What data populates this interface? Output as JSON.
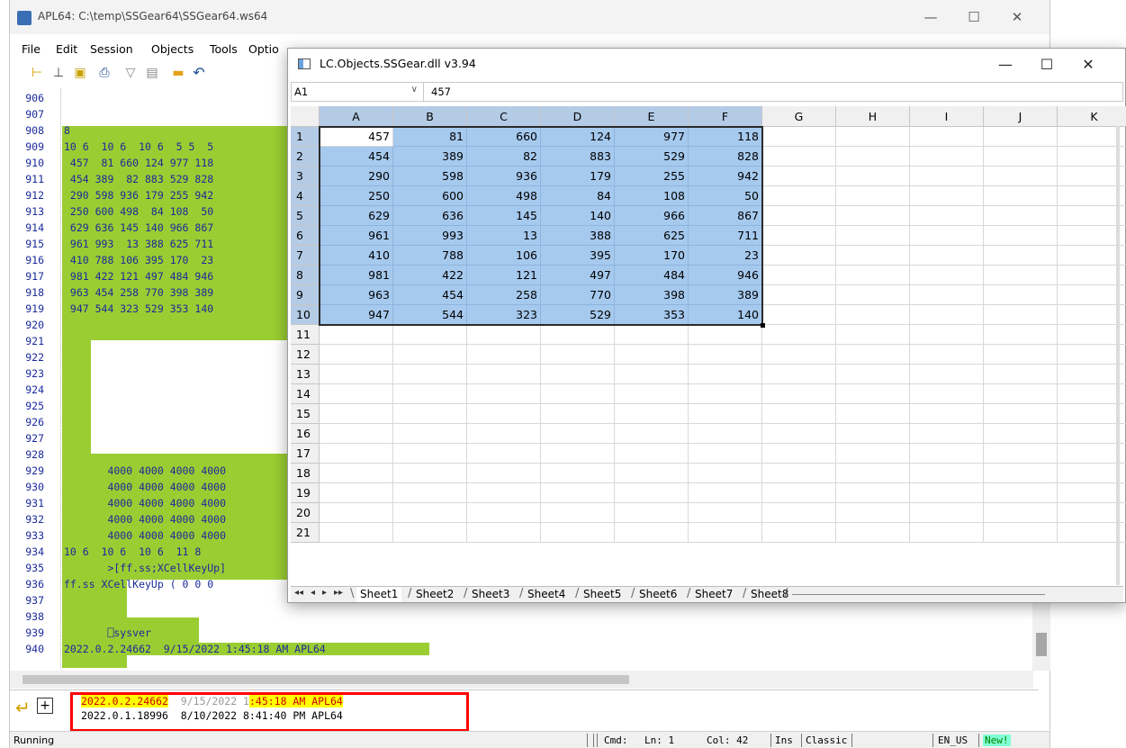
{
  "main_window": {
    "title": "APL64: C:\\temp\\SSGear64\\SSGear64.ws64",
    "controls": {
      "minimize": "—",
      "maximize": "☐",
      "close": "✕"
    }
  },
  "menu": [
    "File",
    "Edit",
    "Session",
    "Objects",
    "Tools",
    "Optio"
  ],
  "toolbar_icons": [
    "indent-icon",
    "step-icon",
    "save-icon",
    "print-icon",
    "shape-icon",
    "document-icon",
    "folder-icon",
    "undo-icon"
  ],
  "session": {
    "line_numbers": [
      "906",
      "907",
      "908",
      "909",
      "910",
      "911",
      "912",
      "913",
      "914",
      "915",
      "916",
      "917",
      "918",
      "919",
      "920",
      "921",
      "922",
      "923",
      "924",
      "925",
      "926",
      "927",
      "928",
      "929",
      "930",
      "931",
      "932",
      "933",
      "934",
      "935",
      "936",
      "937",
      "938",
      "939",
      "940"
    ],
    "lines": {
      "l908": "8",
      "l909": "10 6  10 6  10 6  5 5  5",
      "l910": " 457  81 660 124 977 118",
      "l911": " 454 389  82 883 529 828",
      "l912": " 290 598 936 179 255 942",
      "l913": " 250 600 498  84 108  50",
      "l914": " 629 636 145 140 966 867",
      "l915": " 961 993  13 388 625 711",
      "l916": " 410 788 106 395 170  23",
      "l917": " 981 422 121 497 484 946",
      "l918": " 963 454 258 770 398 389",
      "l919": " 947 544 323 529 353 140",
      "l928": "       4000 4000 4000 4000",
      "l929": "       4000 4000 4000 4000",
      "l930": "       4000 4000 4000 4000",
      "l931": "       4000 4000 4000 4000",
      "l932": "       4000 4000 4000 4000",
      "l933": "10 6  10 6  10 6  11 8",
      "l934": "       >[ff.ss;XCellKeyUp]",
      "l935": "ff.ss XCellKeyUp ( 0 0 0",
      "l938": "       ⎕sysver",
      "l939": "2022.0.2.24662  9/15/2022 1:45:18 AM APL64"
    }
  },
  "history": {
    "entry1": {
      "version": "2022.0.2.24662",
      "date_a": "9/15/",
      "date_b": "2022 1",
      "time": ":45:18 AM APL64"
    },
    "entry2": "2022.0.1.18996  8/10/2022 8:41:40 PM APL64"
  },
  "statusbar": {
    "state": "Running",
    "cmd": "Cmd:",
    "ln": "Ln: 1",
    "col": "Col: 42",
    "mode": "Ins",
    "style": "Classic",
    "locale": "EN_US",
    "new": "New!"
  },
  "spreadsheet": {
    "title": "LC.Objects.SSGear.dll v3.94",
    "controls": {
      "minimize": "—",
      "maximize": "☐",
      "close": "✕"
    },
    "name_box": "A1",
    "dropdown": "∨",
    "formula": "457",
    "columns": [
      "A",
      "B",
      "C",
      "D",
      "E",
      "F",
      "G",
      "H",
      "I",
      "J",
      "K"
    ],
    "rows": [
      "1",
      "2",
      "3",
      "4",
      "5",
      "6",
      "7",
      "8",
      "9",
      "10",
      "11",
      "12",
      "13",
      "14",
      "15",
      "16",
      "17",
      "18",
      "19",
      "20",
      "21"
    ],
    "values": [
      [
        "457",
        "81",
        "660",
        "124",
        "977",
        "118"
      ],
      [
        "454",
        "389",
        "82",
        "883",
        "529",
        "828"
      ],
      [
        "290",
        "598",
        "936",
        "179",
        "255",
        "942"
      ],
      [
        "250",
        "600",
        "498",
        "84",
        "108",
        "50"
      ],
      [
        "629",
        "636",
        "145",
        "140",
        "966",
        "867"
      ],
      [
        "961",
        "993",
        "13",
        "388",
        "625",
        "711"
      ],
      [
        "410",
        "788",
        "106",
        "395",
        "170",
        "23"
      ],
      [
        "981",
        "422",
        "121",
        "497",
        "484",
        "946"
      ],
      [
        "963",
        "454",
        "258",
        "770",
        "398",
        "389"
      ],
      [
        "947",
        "544",
        "323",
        "529",
        "353",
        "140"
      ]
    ],
    "tab_nav": [
      "◂◂",
      "◂",
      "▸",
      "▸▸"
    ],
    "sheets": [
      "Sheet1",
      "Sheet2",
      "Sheet3",
      "Sheet4",
      "Sheet5",
      "Sheet6",
      "Sheet7",
      "Sheet8"
    ]
  },
  "colors": {
    "session_highlight": "#9acd32",
    "selection": "#a6c9ee",
    "history_highlight": "#ffff00",
    "box": "#ff0000"
  }
}
